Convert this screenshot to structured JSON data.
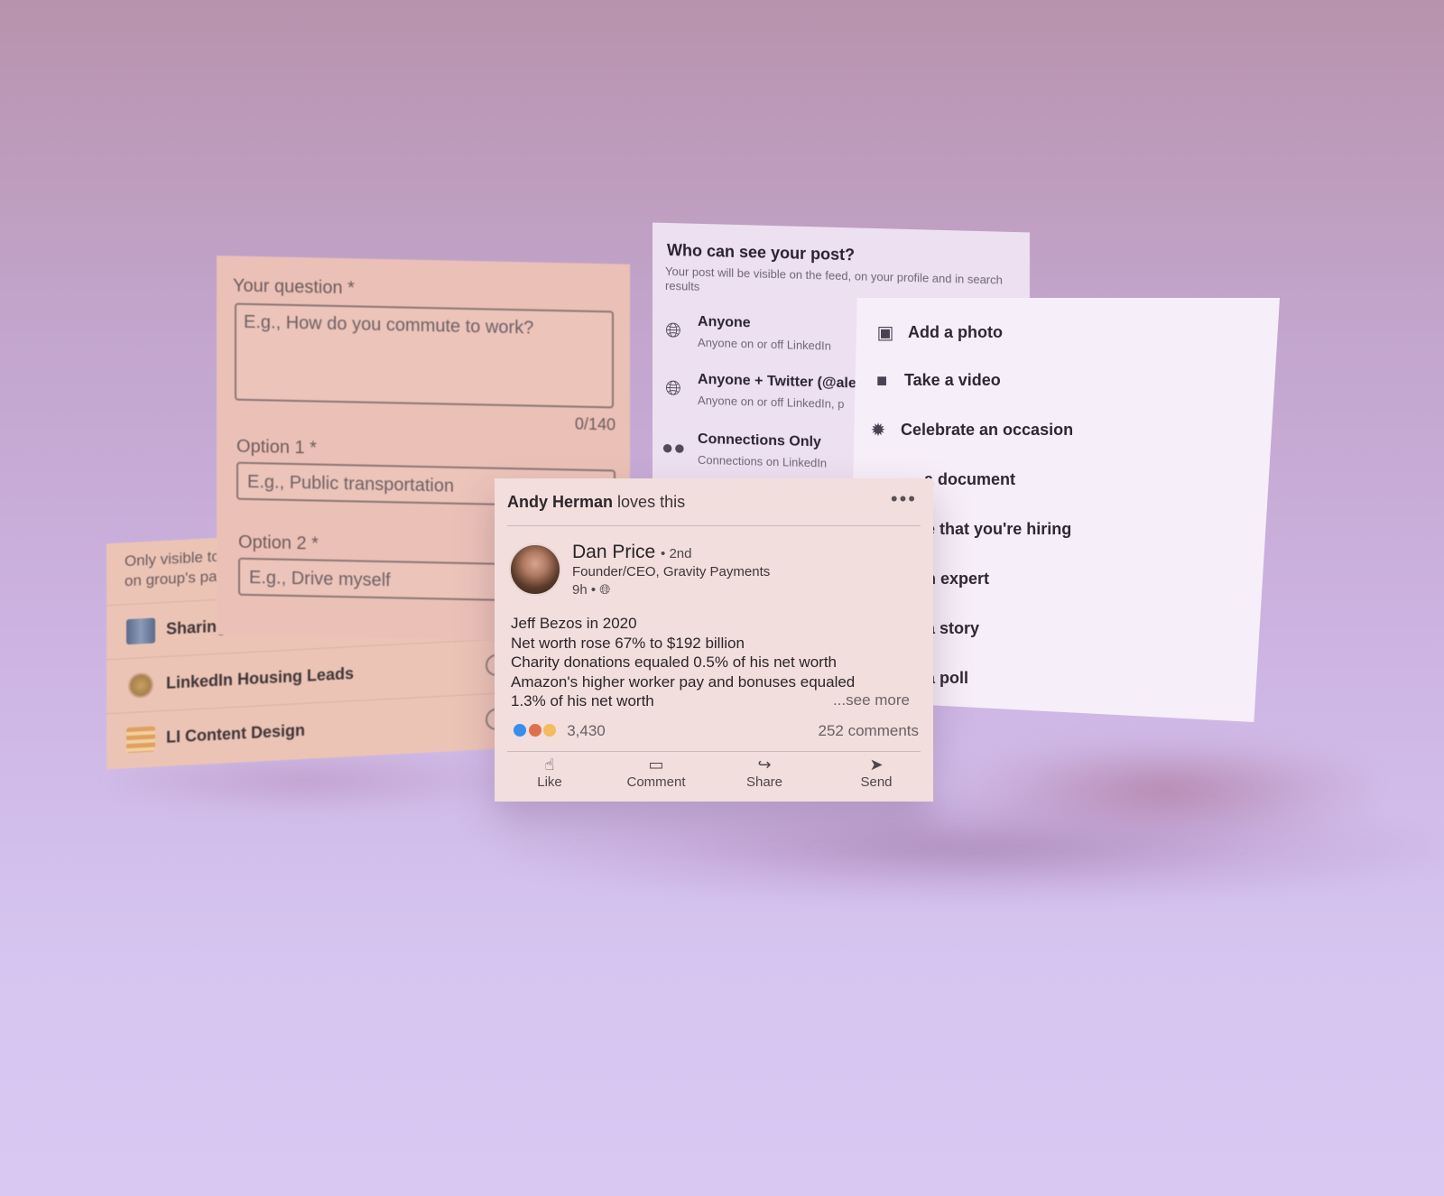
{
  "groups": {
    "note_line1": "Only visible to",
    "note_line2": "on group's pa",
    "items": [
      {
        "label": "Sharing"
      },
      {
        "label": "LinkedIn Housing Leads"
      },
      {
        "label": "LI Content Design"
      }
    ]
  },
  "poll": {
    "question_label": "Your question *",
    "question_placeholder": "E.g., How do you commute to work?",
    "counter": "0/140",
    "option1_label": "Option 1 *",
    "option1_placeholder": "E.g., Public transportation",
    "option2_label": "Option 2 *",
    "option2_placeholder": "E.g., Drive myself"
  },
  "visibility": {
    "title": "Who can see your post?",
    "subtitle": "Your post will be visible on the feed, on your profile and in search results",
    "options": [
      {
        "name": "Anyone",
        "desc": "Anyone on or off LinkedIn",
        "icon": "globe-icon"
      },
      {
        "name": "Anyone + Twitter (@alex",
        "desc": "Anyone on or off LinkedIn, p",
        "icon": "globe-icon"
      },
      {
        "name": "Connections Only",
        "desc": "Connections on LinkedIn",
        "icon": "people-icon"
      }
    ]
  },
  "actions": {
    "items": [
      {
        "label": "Add a photo",
        "icon": "photo-icon"
      },
      {
        "label": "Take a video",
        "icon": "video-icon"
      },
      {
        "label": "Celebrate an occasion",
        "icon": "badge-icon"
      },
      {
        "label": "a document",
        "icon": "document-icon"
      },
      {
        "label": "e that you're hiring",
        "icon": ""
      },
      {
        "label": "n expert",
        "icon": ""
      },
      {
        "label": "a story",
        "icon": ""
      },
      {
        "label": "a poll",
        "icon": ""
      }
    ]
  },
  "post": {
    "activity_actor": "Andy Herman",
    "activity_text": "loves this",
    "more_label": "•••",
    "author_name": "Dan Price",
    "author_degree": "• 2nd",
    "author_headline": "Founder/CEO, Gravity Payments",
    "time": "9h •",
    "body_lines": [
      "Jeff Bezos in 2020",
      "Net worth rose 67% to $192 billion",
      "Charity donations equaled 0.5% of his net worth",
      "Amazon's higher worker pay and bonuses equaled",
      "1.3% of his net worth"
    ],
    "see_more": "...see more",
    "reaction_count": "3,430",
    "comments": "252 comments",
    "buttons": {
      "like": "Like",
      "comment": "Comment",
      "share": "Share",
      "send": "Send"
    },
    "colors": {
      "like": "#378fe9",
      "love": "#df704d",
      "insight": "#f5bb5c"
    }
  }
}
